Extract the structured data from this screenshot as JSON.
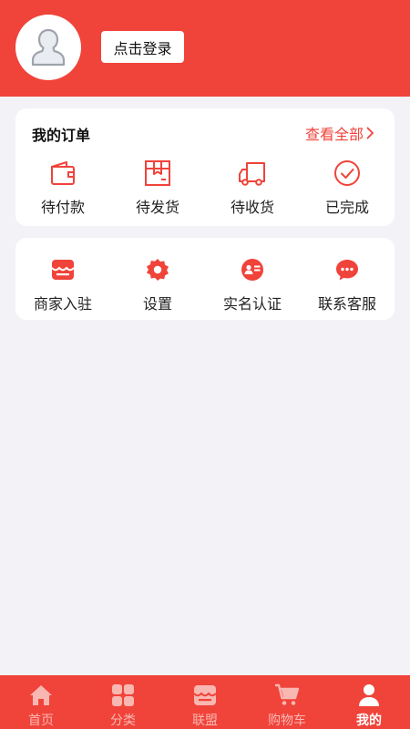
{
  "profile": {
    "login_label": "点击登录"
  },
  "orders": {
    "title": "我的订单",
    "view_all": "查看全部",
    "items": [
      {
        "label": "待付款",
        "icon": "wallet-icon"
      },
      {
        "label": "待发货",
        "icon": "package-icon"
      },
      {
        "label": "待收货",
        "icon": "truck-icon"
      },
      {
        "label": "已完成",
        "icon": "check-circle-icon"
      }
    ]
  },
  "services": {
    "items": [
      {
        "label": "商家入驻",
        "icon": "store-icon"
      },
      {
        "label": "设置",
        "icon": "gear-icon"
      },
      {
        "label": "实名认证",
        "icon": "id-card-icon"
      },
      {
        "label": "联系客服",
        "icon": "chat-icon"
      }
    ]
  },
  "tabbar": {
    "items": [
      {
        "label": "首页",
        "icon": "home-icon"
      },
      {
        "label": "分类",
        "icon": "grid-icon"
      },
      {
        "label": "联盟",
        "icon": "store-icon"
      },
      {
        "label": "购物车",
        "icon": "cart-icon"
      },
      {
        "label": "我的",
        "icon": "user-icon",
        "active": true
      }
    ]
  },
  "colors": {
    "accent": "#f0433a",
    "background": "#f3f3f7",
    "tab_inactive": "#f9b7b2"
  }
}
